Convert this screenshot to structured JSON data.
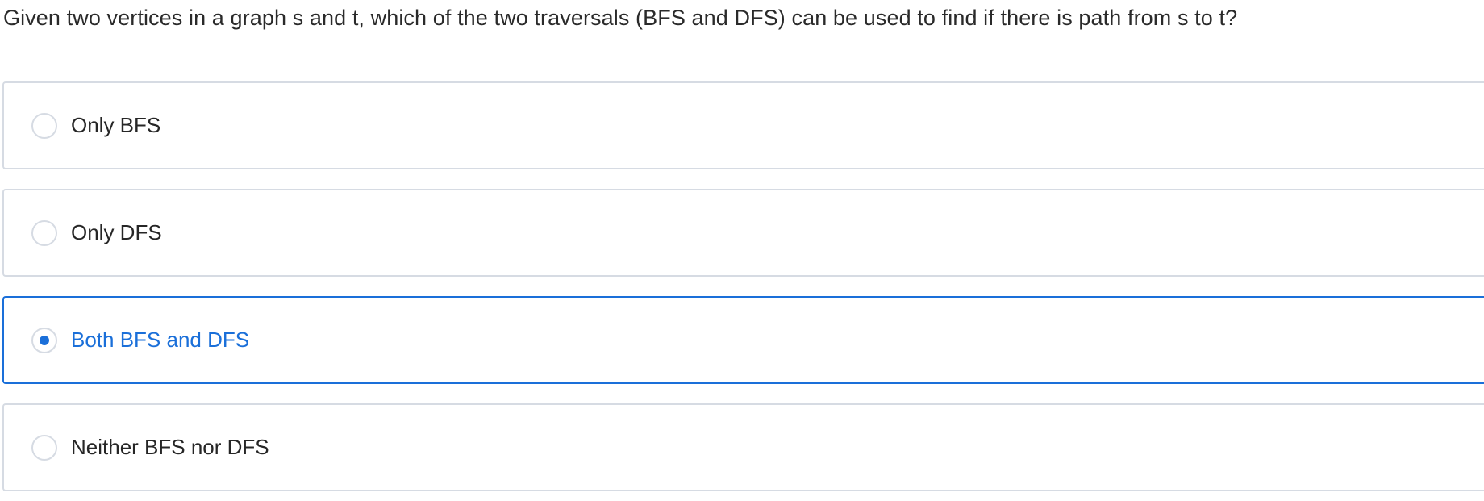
{
  "question": {
    "text": "Given two vertices in a graph s and t, which of the two traversals (BFS and DFS) can be used to find if there is path from s to t?"
  },
  "options": [
    {
      "label": "Only BFS",
      "selected": false
    },
    {
      "label": "Only DFS",
      "selected": false
    },
    {
      "label": "Both BFS and DFS",
      "selected": true
    },
    {
      "label": "Neither BFS nor DFS",
      "selected": false
    }
  ],
  "colors": {
    "accent": "#1a6fd9",
    "border": "#d6dbe3",
    "text": "#262626"
  }
}
